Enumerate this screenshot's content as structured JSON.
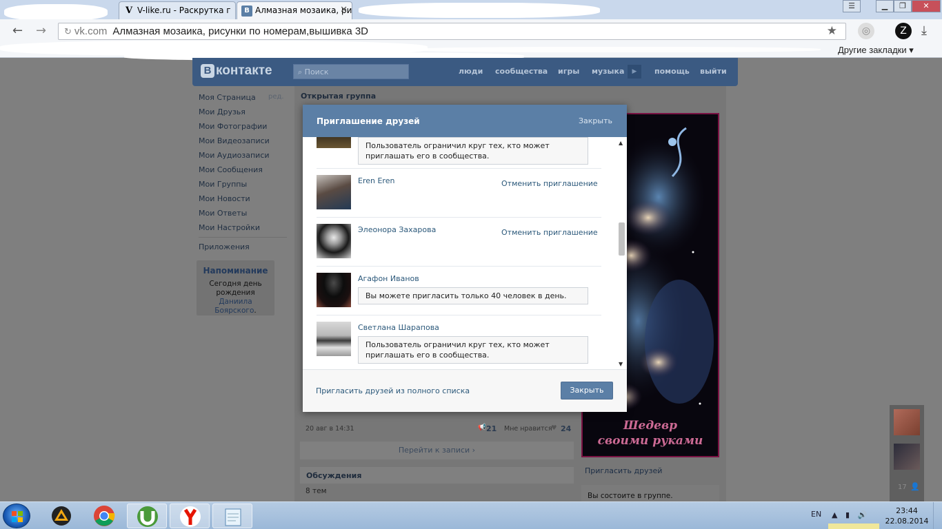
{
  "browser": {
    "tabs": [
      {
        "favicon": "V",
        "title": "V-like.ru - Раскрутка г"
      },
      {
        "favicon": "В",
        "title": "Алмазная мозаика, ри"
      }
    ],
    "address": {
      "domain": "vk.com",
      "title": "Алмазная мозаика, рисунки по номерам,вышивка 3D"
    },
    "bookmarks": {
      "other": "Другие закладки"
    }
  },
  "vk": {
    "logo_text": "контакте",
    "logo_letter": "В",
    "search_placeholder": "Поиск",
    "nav": [
      "люди",
      "сообщества",
      "игры",
      "музыка",
      "помощь",
      "выйти"
    ],
    "menu": [
      "Моя Страница",
      "Мои Друзья",
      "Мои Фотографии",
      "Мои Видеозаписи",
      "Мои Аудиозаписи",
      "Мои Сообщения",
      "Мои Группы",
      "Мои Новости",
      "Мои Ответы",
      "Мои Настройки"
    ],
    "menu_edit": "ред.",
    "apps": "Приложения",
    "reminder": {
      "title": "Напоминание",
      "text_before": "Сегодня день рождения",
      "name": "Даниила Боярского",
      "text_after": "."
    },
    "group_type": "Открытая группа",
    "group_caption": [
      "Шедевр",
      "своими руками"
    ],
    "invite_friends": "Пригласить друзей",
    "member_status": "Вы состоите в группе.",
    "post_date": "20 авг в 14:31",
    "reposts": "21",
    "likes_label": "Мне нравится",
    "likes": "24",
    "goto_post": "Перейти к записи",
    "discussions": "Обсуждения",
    "discussions_count": "8 тем",
    "side_count": "17"
  },
  "modal": {
    "title": "Приглашение друзей",
    "close_link": "Закрыть",
    "rows": [
      {
        "name": "",
        "notice": "Пользователь ограничил круг тех, кто может приглашать его в сообщества."
      },
      {
        "name": "Eren Eren",
        "action": "Отменить приглашение"
      },
      {
        "name": "Элеонора Захарова",
        "action": "Отменить приглашение"
      },
      {
        "name": "Агафон Иванов",
        "notice": "Вы можете пригласить только 40 человек в день."
      },
      {
        "name": "Светлана Шарапова",
        "notice": "Пользователь ограничил круг тех, кто может приглашать его в сообщества."
      }
    ],
    "full_list": "Пригласить друзей из полного списка",
    "close_button": "Закрыть"
  },
  "taskbar": {
    "lang": "EN",
    "time": "23:44",
    "date": "22.08.2014"
  },
  "colors": {
    "vk_header": "#3b5a82",
    "modal_header": "#5b7fa6",
    "link": "#2b587a"
  }
}
